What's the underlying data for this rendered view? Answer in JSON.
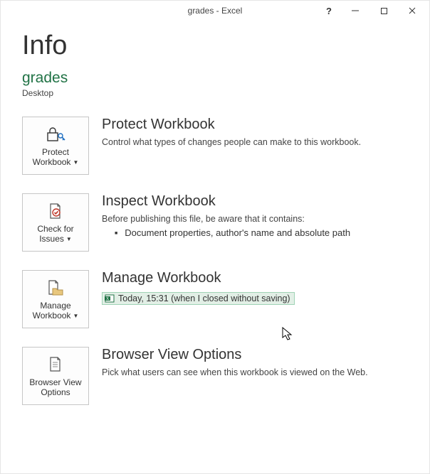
{
  "titlebar": {
    "title": "grades - Excel"
  },
  "page": {
    "title": "Info"
  },
  "doc": {
    "name": "grades",
    "path": "Desktop"
  },
  "sections": {
    "protect": {
      "tile": "Protect Workbook",
      "title": "Protect Workbook",
      "desc": "Control what types of changes people can make to this workbook."
    },
    "inspect": {
      "tile": "Check for Issues",
      "title": "Inspect Workbook",
      "desc": "Before publishing this file, be aware that it contains:",
      "bullet": "Document properties, author's name and absolute path"
    },
    "manage": {
      "tile": "Manage Workbook",
      "title": "Manage Workbook",
      "version_label": "Today, 15:31 (when I closed without saving)"
    },
    "browser": {
      "tile": "Browser View Options",
      "title": "Browser View Options",
      "desc": "Pick what users can see when this workbook is viewed on the Web."
    }
  }
}
